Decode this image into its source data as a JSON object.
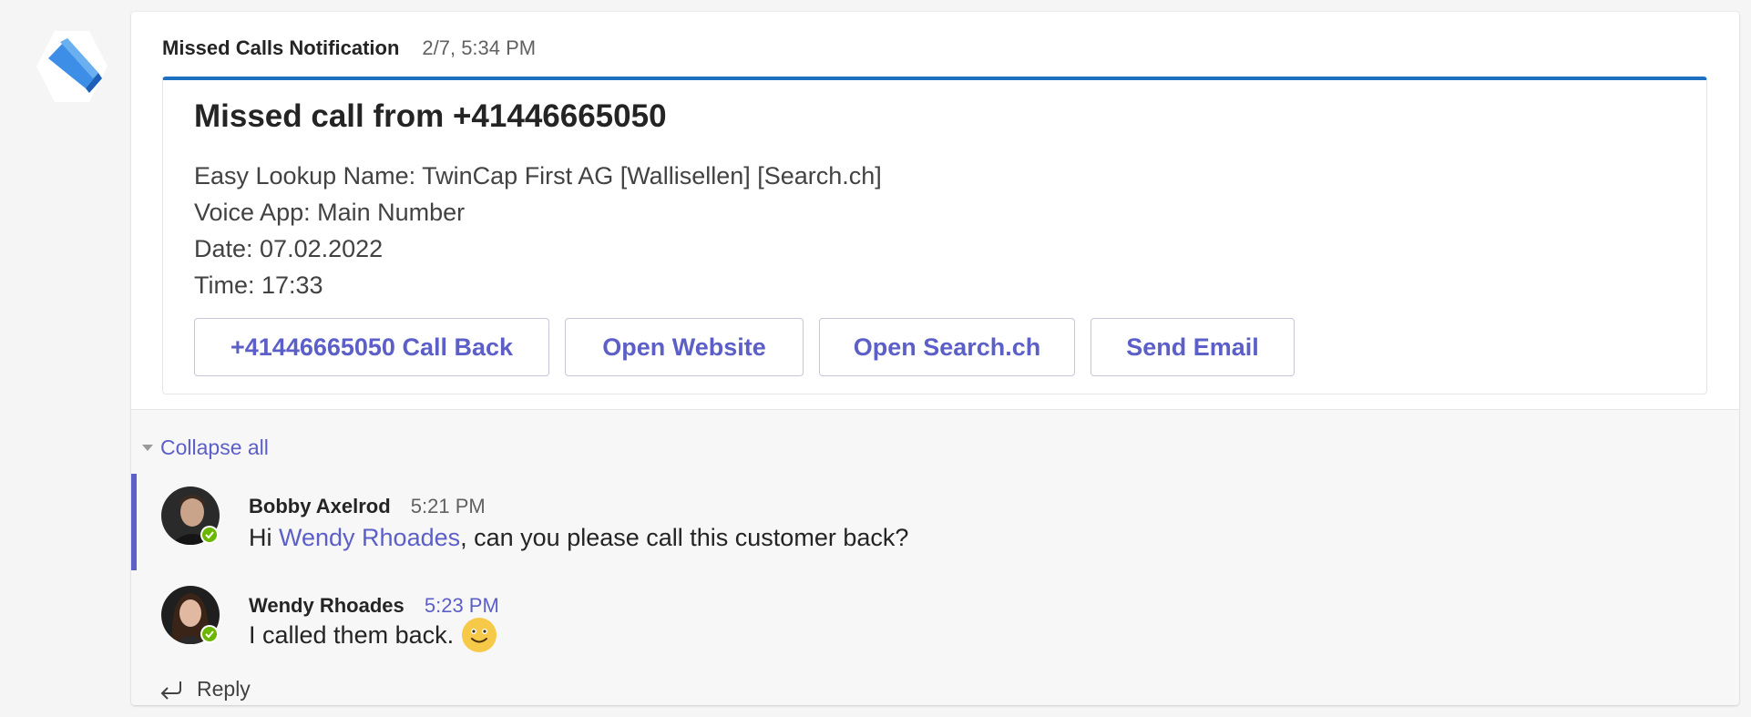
{
  "post": {
    "sender": "Missed Calls Notification",
    "timestamp": "2/7, 5:34 PM"
  },
  "card": {
    "title": "Missed call from +41446665050",
    "lines": [
      "Easy Lookup Name: TwinCap First AG [Wallisellen] [Search.ch]",
      "Voice App: Main Number",
      "Date: 07.02.2022",
      "Time: 17:33"
    ],
    "actions": [
      "+41446665050 Call Back",
      "Open Website",
      "Open Search.ch",
      "Send Email"
    ],
    "accent_color": "#1d6fbf"
  },
  "thread": {
    "collapse_label": "Collapse all",
    "replies": [
      {
        "name": "Bobby Axelrod",
        "time": "5:21 PM",
        "text_before": "Hi ",
        "mention": "Wendy Rhoades",
        "text_after": ", can you please call this customer back?"
      },
      {
        "name": "Wendy Rhoades",
        "time": "5:23 PM",
        "text": "I called them back.",
        "emoji": "smile-emoji"
      }
    ],
    "reply_label": "Reply"
  },
  "colors": {
    "brand": "#5b5fc7",
    "presence": "#6bb700"
  }
}
